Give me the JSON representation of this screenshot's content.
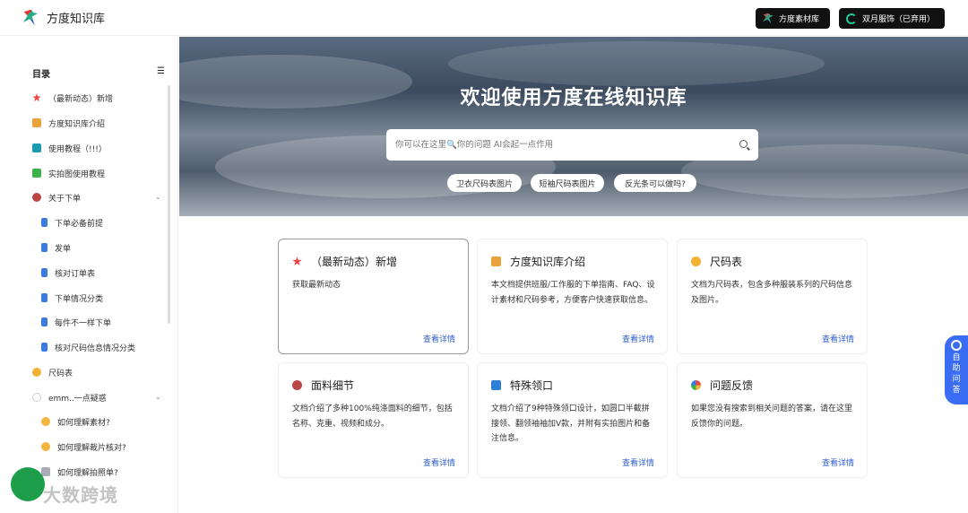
{
  "header": {
    "brand": "方度知识库",
    "buttons": [
      {
        "label": "方度素材库"
      },
      {
        "label": "双月服饰（已弃用）"
      }
    ]
  },
  "sidebar": {
    "title": "目录",
    "items": [
      {
        "label": "（最新动态）新增",
        "icon": "star-icon"
      },
      {
        "label": "方度知识库介绍",
        "icon": "cube-icon"
      },
      {
        "label": "使用教程（!!!）",
        "icon": "book-icon"
      },
      {
        "label": "实拍图使用教程",
        "icon": "shirt-icon"
      },
      {
        "label": "关于下单",
        "icon": "person-icon"
      },
      {
        "label": "下单必备前提",
        "icon": "doc-icon"
      },
      {
        "label": "发单",
        "icon": "doc-icon"
      },
      {
        "label": "核对订单表",
        "icon": "doc-icon"
      },
      {
        "label": "下单情况分类",
        "icon": "doc-icon"
      },
      {
        "label": "每件不一样下单",
        "icon": "doc-icon"
      },
      {
        "label": "核对尺码信息情况分类",
        "icon": "doc-icon"
      },
      {
        "label": "尺码表",
        "icon": "hand-icon"
      },
      {
        "label": "emm..一点疑惑",
        "icon": "circle-icon"
      },
      {
        "label": "如何理解素材?",
        "icon": "face-icon"
      },
      {
        "label": "如何理解裁片核对?",
        "icon": "face-icon"
      },
      {
        "label": "如何理解拍照单?",
        "icon": "image-icon"
      }
    ]
  },
  "hero": {
    "title": "欢迎使用方度在线知识库",
    "search_placeholder": "你可以在这里🔍你的问题 AI会起一点作用",
    "chips": [
      "卫衣尺码表图片",
      "短袖尺码表图片",
      "反光条可以做吗?"
    ]
  },
  "cards": [
    {
      "title": "（最新动态）新增",
      "desc": "获取最新动态",
      "link": "查看详情",
      "icon": "star-icon"
    },
    {
      "title": "方度知识库介绍",
      "desc": "本文档提供班服/工作服的下单指南、FAQ、设计素材和尺码参考，方便客户快速获取信息。",
      "link": "查看详情",
      "icon": "cube-icon"
    },
    {
      "title": "尺码表",
      "desc": "文档为尺码表，包含多种服装系列的尺码信息及图片。",
      "link": "查看详情",
      "icon": "hand-icon"
    },
    {
      "title": "面料细节",
      "desc": "文档介绍了多种100%纯涤面料的细节，包括名称、克重、视频和成分。",
      "link": "查看详情",
      "icon": "person-icon"
    },
    {
      "title": "特殊领口",
      "desc": "文档介绍了9种特殊领口设计，如圆口半截拼接领、翻领袖袖加V款，并附有实拍图片和备注信息。",
      "link": "查看详情",
      "icon": "box-icon"
    },
    {
      "title": "问题反馈",
      "desc": "如果您没有搜索到相关问题的答案，请在这里反馈你的问题。",
      "link": "查看详情",
      "icon": "globe-icon"
    }
  ],
  "help": {
    "label": "自助问答"
  },
  "watermark": {
    "text": "大数跨境"
  }
}
